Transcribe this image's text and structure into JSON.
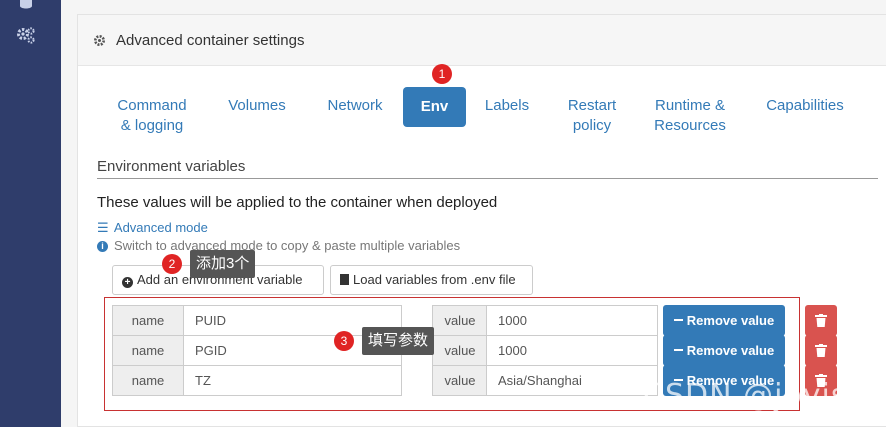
{
  "panel": {
    "title": "Advanced container settings"
  },
  "tabs": [
    {
      "line1": "Command",
      "line2": "& logging"
    },
    {
      "line1": "Volumes"
    },
    {
      "line1": "Network"
    },
    {
      "line1": "Env"
    },
    {
      "line1": "Labels"
    },
    {
      "line1": "Restart",
      "line2": "policy"
    },
    {
      "line1": "Runtime &",
      "line2": "Resources"
    },
    {
      "line1": "Capabilities"
    }
  ],
  "active_tab": "Env",
  "env": {
    "section_title": "Environment variables",
    "description": "These values will be applied to the container when deployed",
    "advanced_mode": "Advanced mode",
    "info": "Switch to advanced mode to copy & paste multiple variables",
    "add_button": "Add an environment variable",
    "load_button": "Load variables from .env file",
    "name_label": "name",
    "value_label": "value",
    "remove_label": "Remove value",
    "rows": [
      {
        "name": "PUID",
        "value": "1000"
      },
      {
        "name": "PGID",
        "value": "1000"
      },
      {
        "name": "TZ",
        "value": "Asia/Shanghai"
      }
    ]
  },
  "annotations": {
    "badges": [
      "1",
      "2",
      "3"
    ],
    "tip_add": "添加3个",
    "tip_fill": "填写参数"
  },
  "watermark": "CSDN @joyist",
  "colors": {
    "primary": "#337ab7",
    "danger": "#d9534f",
    "annotation": "#e02424",
    "sidebar": "#2f3d6b"
  }
}
